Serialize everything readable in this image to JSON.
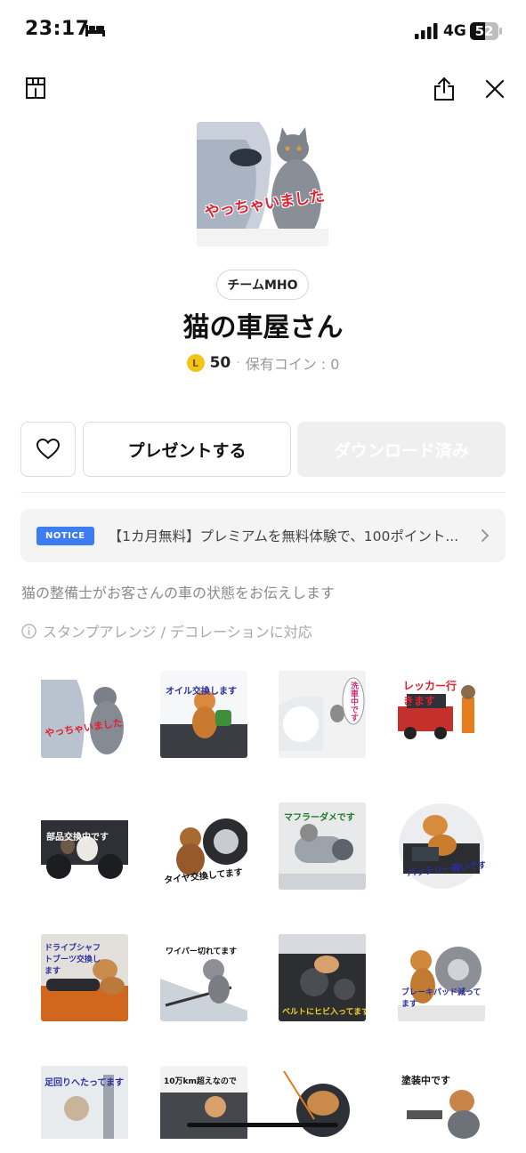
{
  "status_bar": {
    "time": "23:17",
    "network": "4G",
    "battery": "52"
  },
  "header": {
    "shop_icon": "shop-icon",
    "share_icon": "share-icon",
    "close_icon": "close-icon"
  },
  "package": {
    "creator": "チームMHO",
    "title": "猫の車屋さん",
    "coin_symbol": "L",
    "price": "50",
    "owned_coins": "保有コイン : 0",
    "hero_caption": "やっちゃいました"
  },
  "actions": {
    "like_icon": "heart-icon",
    "gift_label": "プレゼントする",
    "download_label": "ダウンロード済み"
  },
  "notice": {
    "badge": "NOTICE",
    "text": "【1カ月無料】プレミアムを無料体験で、100ポイント..."
  },
  "description": "猫の整備士がお客さんの車の状態をお伝えします",
  "feature": "スタンプアレンジ / デコレーションに対応",
  "stickers": [
    {
      "caption": "やっちゃいました"
    },
    {
      "caption": "オイル交換します"
    },
    {
      "caption": "洗車中です"
    },
    {
      "caption": "レッカー行きます"
    },
    {
      "caption": "部品交換中です"
    },
    {
      "caption": "タイヤ交換してます"
    },
    {
      "caption": "マフラーダメです"
    },
    {
      "caption": "バッテリー弱いです"
    },
    {
      "caption": "ドライブシャフトブーツ交換します"
    },
    {
      "caption": "ワイパー切れてます"
    },
    {
      "caption": "ベルトにヒビ入ってます"
    },
    {
      "caption": "ブレーキパッド減ってます"
    },
    {
      "caption": "足回りへたってます"
    },
    {
      "caption": "10万km超えなので"
    },
    {
      "caption": ""
    },
    {
      "caption": "塗装中です"
    }
  ]
}
